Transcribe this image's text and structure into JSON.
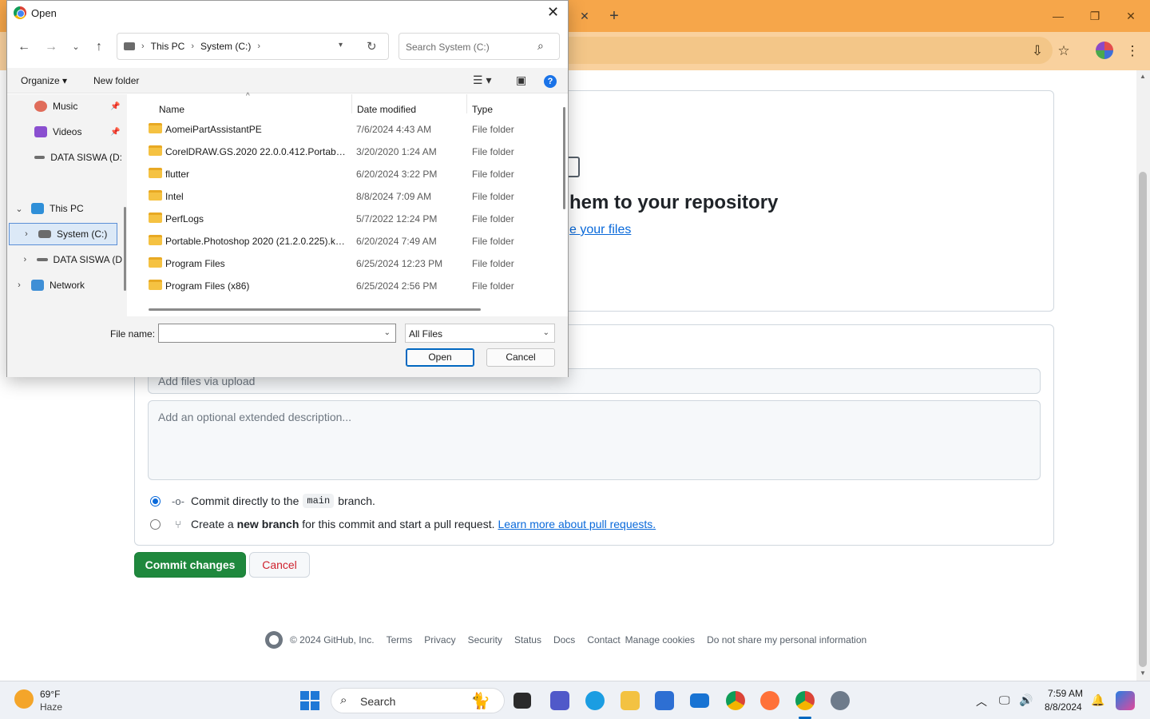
{
  "browser": {
    "tab_close": "✕",
    "new_tab": "+",
    "controls": {
      "minimize": "—",
      "restore": "❐",
      "close": "✕"
    },
    "toolbar_icons": [
      "install-app-icon",
      "bookmark-star-icon",
      "profile-avatar",
      "menu-dots-icon"
    ]
  },
  "github": {
    "drop_title": "hem to your repository",
    "drop_link": "e your files",
    "commit_summary_placeholder": "Add files via upload",
    "description_placeholder": "Add an optional extended description...",
    "commit_direct_prefix": "Commit directly to the",
    "branch_name": "main",
    "commit_direct_suffix": "branch.",
    "new_branch_prefix": "Create a",
    "new_branch_bold": "new branch",
    "new_branch_suffix": "for this commit and start a pull request.",
    "pull_request_link": "Learn more about pull requests.",
    "commit_button": "Commit changes",
    "cancel_button": "Cancel",
    "footer": {
      "copyright": "© 2024 GitHub, Inc.",
      "links": [
        "Terms",
        "Privacy",
        "Security",
        "Status",
        "Docs",
        "Contact",
        "Manage cookies",
        "Do not share my personal information"
      ]
    }
  },
  "dialog": {
    "title": "Open",
    "close": "✕",
    "breadcrumbs": [
      "This PC",
      "System (C:)"
    ],
    "search_placeholder": "Search System (C:)",
    "organize": "Organize ▾",
    "new_folder": "New folder",
    "nav_items": [
      {
        "label": "Music",
        "pinned": true
      },
      {
        "label": "Videos",
        "pinned": true
      },
      {
        "label": "DATA SISWA (D:",
        "pinned": false
      },
      {
        "label": "This PC",
        "expanded": true
      },
      {
        "label": "System (C:)",
        "selected": true
      },
      {
        "label": "DATA SISWA (D",
        "selected": false
      },
      {
        "label": "Network"
      }
    ],
    "columns": {
      "name": "Name",
      "date": "Date modified",
      "type": "Type"
    },
    "files": [
      {
        "name": "AomeiPartAssistantPE",
        "date": "7/6/2024 4:43 AM",
        "type": "File folder"
      },
      {
        "name": "CorelDRAW.GS.2020 22.0.0.412.Portable.x...",
        "date": "3/20/2020 1:24 AM",
        "type": "File folder"
      },
      {
        "name": "flutter",
        "date": "6/20/2024 3:22 PM",
        "type": "File folder"
      },
      {
        "name": "Intel",
        "date": "8/8/2024 7:09 AM",
        "type": "File folder"
      },
      {
        "name": "PerfLogs",
        "date": "5/7/2022 12:24 PM",
        "type": "File folder"
      },
      {
        "name": "Portable.Photoshop 2020 (21.2.0.225).kuy...",
        "date": "6/20/2024 7:49 AM",
        "type": "File folder"
      },
      {
        "name": "Program Files",
        "date": "6/25/2024 12:23 PM",
        "type": "File folder"
      },
      {
        "name": "Program Files (x86)",
        "date": "6/25/2024 2:56 PM",
        "type": "File folder"
      }
    ],
    "file_name_label": "File name:",
    "file_name_value": "",
    "file_type": "All Files",
    "open_button": "Open",
    "cancel_button": "Cancel"
  },
  "taskbar": {
    "temperature": "69°F",
    "condition": "Haze",
    "search_label": "Search",
    "time": "7:59 AM",
    "date": "8/8/2024",
    "pinned_apps": [
      "task-view",
      "teams",
      "edge",
      "file-explorer",
      "microsoft-store",
      "mail",
      "chrome",
      "firefox",
      "chrome-active",
      "settings"
    ]
  }
}
